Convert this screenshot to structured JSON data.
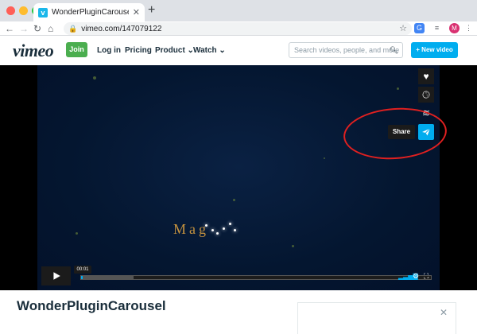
{
  "browser": {
    "tab_title": "WonderPluginCarousel on Vim",
    "tab_close": "✕",
    "new_tab": "+",
    "url": "vimeo.com/147079122",
    "avatar": "M"
  },
  "vimeo": {
    "logo": "vimeo",
    "join": "Join",
    "login": "Log in",
    "pricing": "Pricing",
    "product": "Product",
    "watch": "Watch",
    "search_placeholder": "Search videos, people, and more",
    "new_video": "+ New video"
  },
  "player": {
    "video_text": "Mag",
    "share_tooltip": "Share",
    "current_time": "00:01",
    "progress": 0.003,
    "buffered": 0.15
  },
  "page": {
    "title": "WonderPluginCarousel",
    "panel_close": "✕"
  },
  "colors": {
    "accent": "#00adef",
    "join_green": "#4bae4f",
    "annotation_red": "#e02020"
  }
}
